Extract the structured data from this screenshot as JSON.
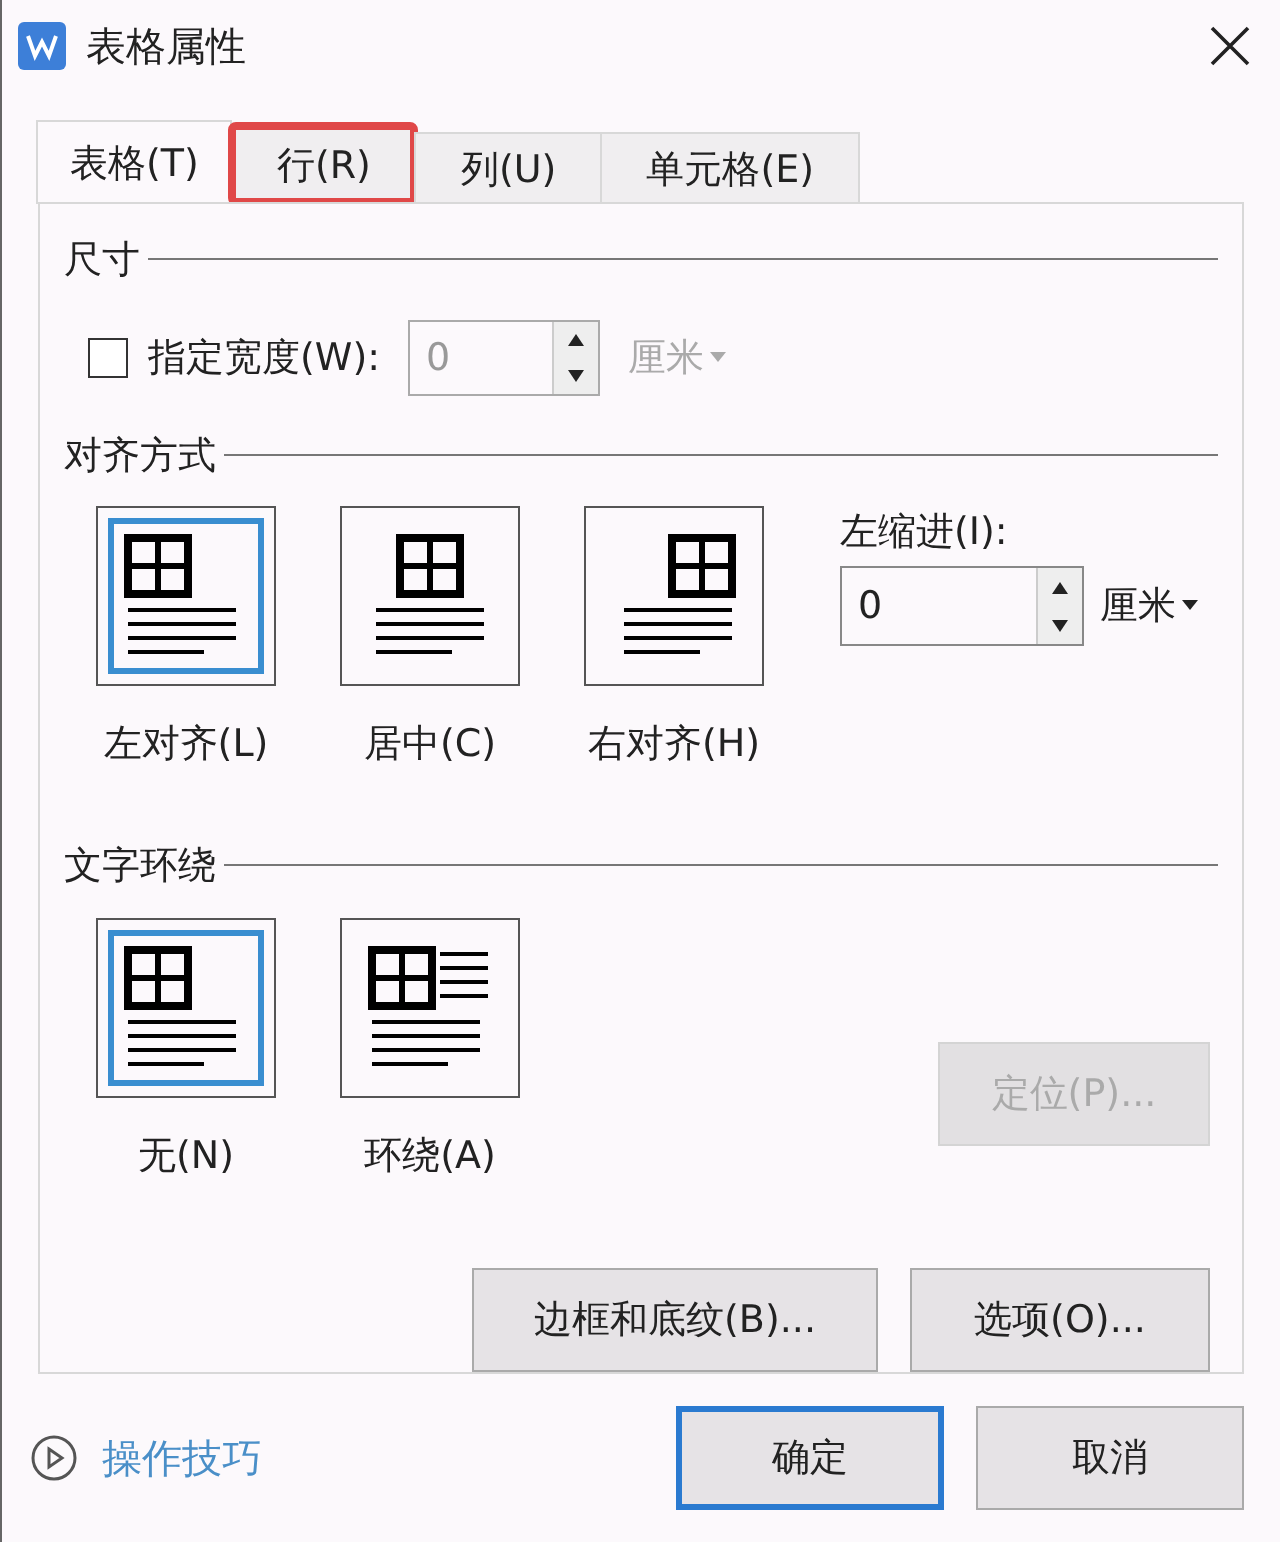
{
  "window": {
    "title": "表格属性"
  },
  "tabs": [
    {
      "label": "表格(T)",
      "selected": true,
      "highlighted": false
    },
    {
      "label": "行(R)",
      "selected": false,
      "highlighted": true
    },
    {
      "label": "列(U)",
      "selected": false,
      "highlighted": false
    },
    {
      "label": "单元格(E)",
      "selected": false,
      "highlighted": false
    }
  ],
  "size": {
    "heading": "尺寸",
    "width_checkbox": {
      "label": "指定宽度(W):",
      "checked": false
    },
    "width_field": {
      "value": "0",
      "disabled": true
    },
    "unit": {
      "label": "厘米",
      "disabled": true
    }
  },
  "alignment": {
    "heading": "对齐方式",
    "options": [
      {
        "kind": "left",
        "label": "左对齐(L)",
        "selected": true
      },
      {
        "kind": "center",
        "label": "居中(C)",
        "selected": false
      },
      {
        "kind": "right",
        "label": "右对齐(H)",
        "selected": false
      }
    ],
    "indent": {
      "label": "左缩进(I):",
      "value": "0",
      "unit": "厘米"
    }
  },
  "wrapping": {
    "heading": "文字环绕",
    "options": [
      {
        "kind": "none",
        "label": "无(N)",
        "selected": true
      },
      {
        "kind": "around",
        "label": "环绕(A)",
        "selected": false
      }
    ],
    "position_button": {
      "label": "定位(P)...",
      "disabled": true
    }
  },
  "buttons": [
    {
      "label": "边框和底纹(B)..."
    },
    {
      "label": "选项(O)..."
    }
  ],
  "footer": {
    "tips": "操作技巧",
    "ok": "确定",
    "cancel": "取消"
  }
}
